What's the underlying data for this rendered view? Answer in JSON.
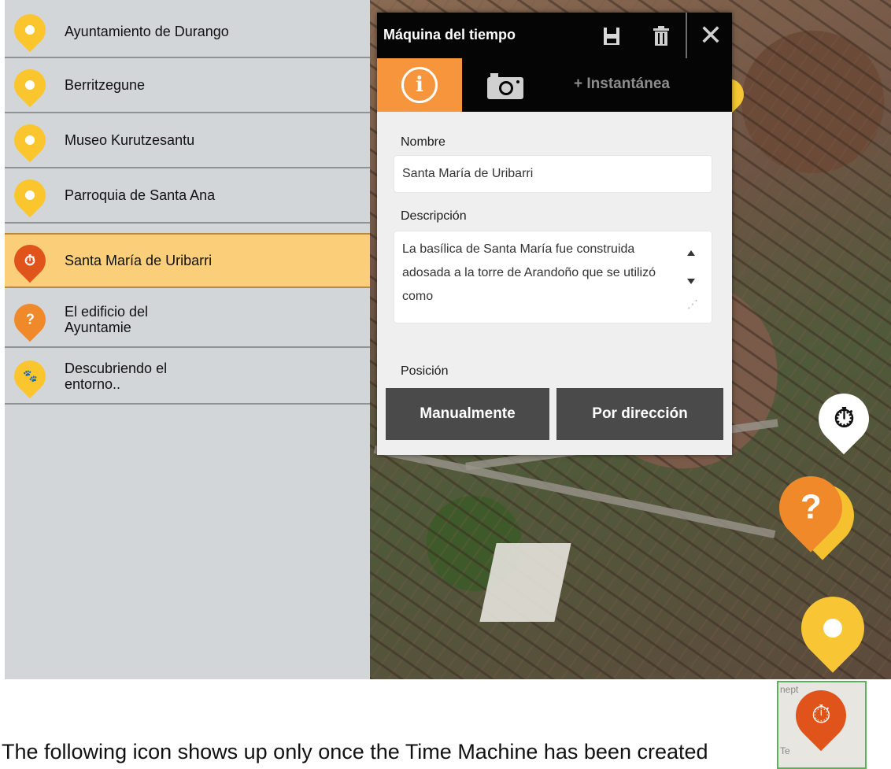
{
  "sidebar": {
    "items": [
      {
        "label": "Ayuntamiento de Durango",
        "icon": "location-dot-icon",
        "color": "#fbc52d"
      },
      {
        "label": "Berritzegune",
        "icon": "location-dot-icon",
        "color": "#fbc52d"
      },
      {
        "label": "Museo Kurutzesantu",
        "icon": "location-dot-icon",
        "color": "#fbc52d"
      },
      {
        "label": "Parroquia de Santa Ana",
        "icon": "location-dot-icon",
        "color": "#fbc52d"
      },
      {
        "label": "Santa María de Uribarri",
        "icon": "stopwatch-icon",
        "color": "#e0541c",
        "selected": true
      },
      {
        "label": "El edificio del Ayuntamie",
        "icon": "question-icon",
        "color": "#f0892a"
      },
      {
        "label": "Descubriendo el entorno..",
        "icon": "paw-icon",
        "color": "#fbc52d"
      }
    ]
  },
  "dialog": {
    "title": "Máquina del tiempo",
    "tabs": {
      "info_icon": "info-icon",
      "camera_icon": "camera-icon",
      "snapshot_label": "+ Instantánea"
    },
    "name_label": "Nombre",
    "name_value": "Santa María de Uribarri",
    "description_label": "Descripción",
    "description_value": "La basílica de Santa María fue construida adosada a la torre de Arandoño que se utilizó como",
    "position_label": "Posición",
    "manual_button": "Manualmente",
    "address_button": "Por dirección",
    "accent_color": "#f7953d"
  },
  "caption": {
    "text": "The following icon shows up only once the Time Machine has been created"
  },
  "thumbnail": {
    "partial_text_top": "nept",
    "partial_text_left": "Te"
  }
}
